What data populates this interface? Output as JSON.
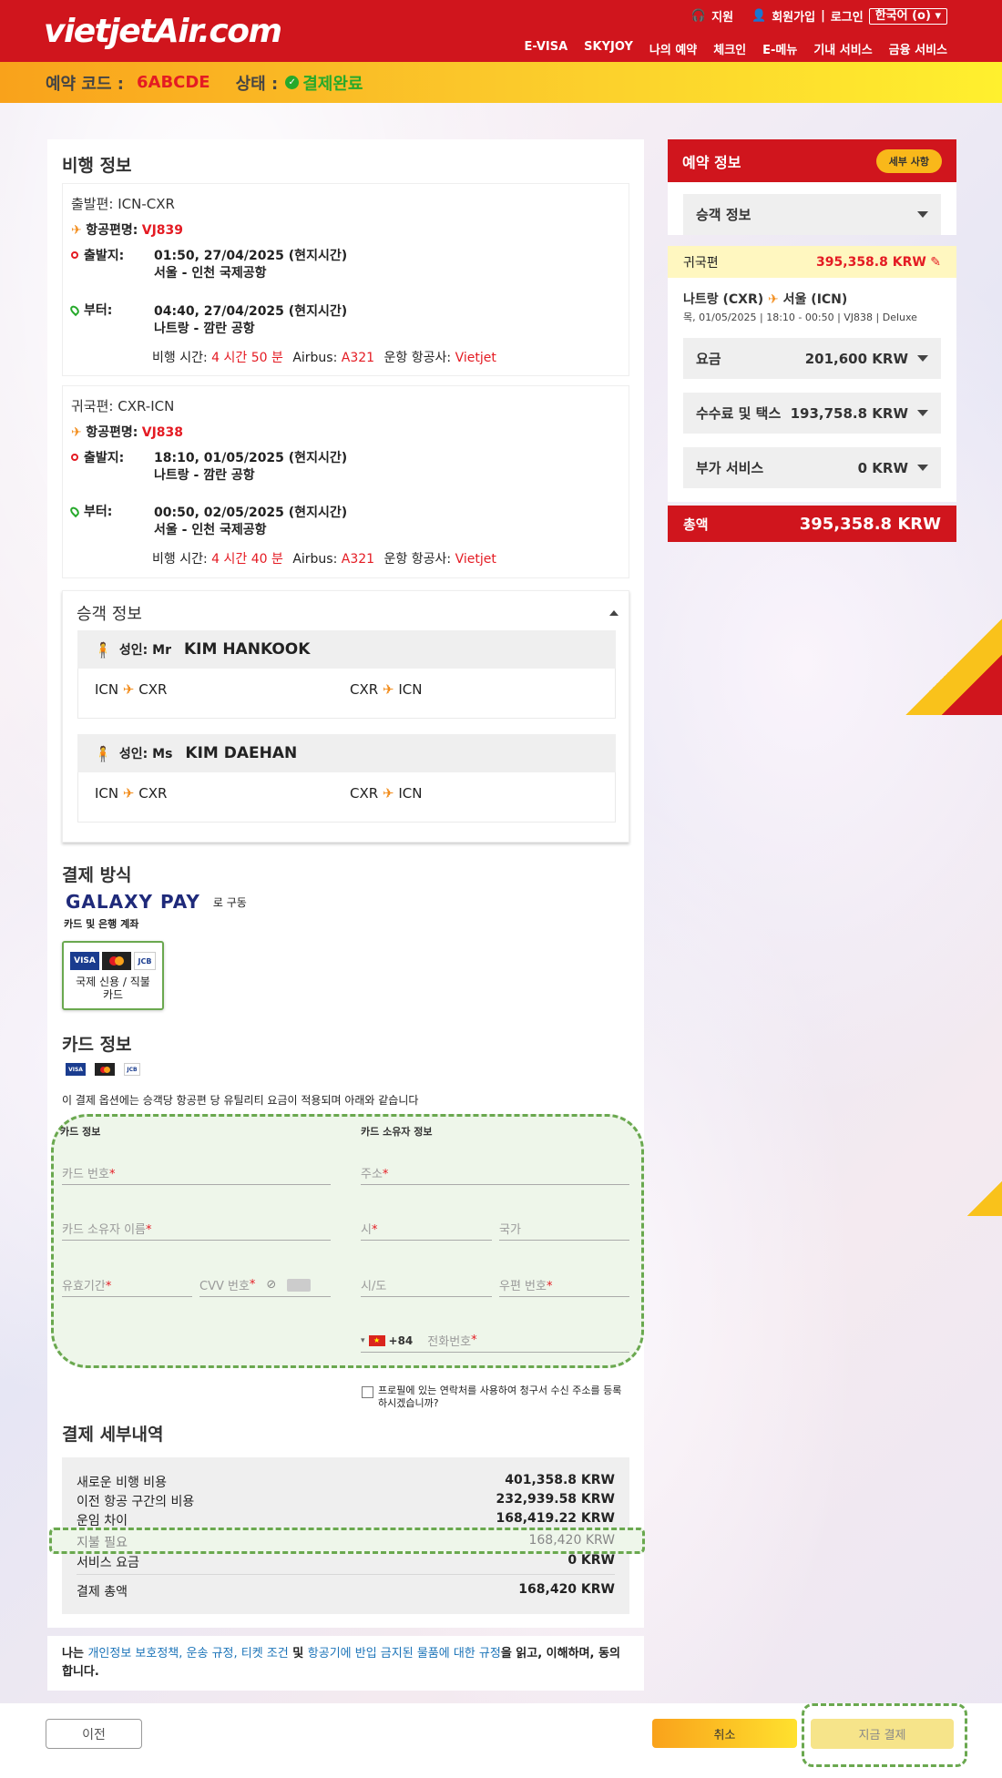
{
  "header": {
    "logo": "vietjetAir.com",
    "support": "지원",
    "signup": "회원가입",
    "login": "로그인",
    "lang": "한국어 (o)",
    "nav": [
      "E-VISA",
      "SKYJOY",
      "나의 예약",
      "체크인",
      "E-메뉴",
      "기내 서비스",
      "금융 서비스"
    ]
  },
  "status_bar": {
    "code_label": "예약 코드 :",
    "code": "6ABCDE",
    "status_label": "상태 :",
    "status": "결제완료"
  },
  "flight_info": {
    "title": "비행 정보",
    "outbound": {
      "title": "출발편: ICN-CXR",
      "flight_label": "항공편명:",
      "flight_no": "VJ839",
      "dep_label": "출발지:",
      "dep_time": "01:50, 27/04/2025 (현지시간)",
      "dep_airport": "서울 - 인천 국제공항",
      "arr_label": "부터:",
      "arr_time": "04:40, 27/04/2025 (현지시간)",
      "arr_airport": "나트랑 - 깜란 공항",
      "dur_label": "비행 시간:",
      "dur": "4 시간 50 분",
      "aircraft_label": "Airbus:",
      "aircraft": "A321",
      "op_label": "운항 항공사:",
      "op": "Vietjet"
    },
    "return": {
      "title": "귀국편: CXR-ICN",
      "flight_label": "항공편명:",
      "flight_no": "VJ838",
      "dep_label": "출발지:",
      "dep_time": "18:10, 01/05/2025 (현지시간)",
      "dep_airport": "나트랑 - 깜란 공항",
      "arr_label": "부터:",
      "arr_time": "00:50, 02/05/2025 (현지시간)",
      "arr_airport": "서울 - 인천 국제공항",
      "dur_label": "비행 시간:",
      "dur": "4 시간 40 분",
      "aircraft_label": "Airbus:",
      "aircraft": "A321",
      "op_label": "운항 항공사:",
      "op": "Vietjet"
    }
  },
  "passengers": {
    "title": "승객 정보",
    "list": [
      {
        "type": "성인: Mr",
        "name": "KIM HANKOOK",
        "route1_from": "ICN",
        "route1_to": "CXR",
        "route2_from": "CXR",
        "route2_to": "ICN"
      },
      {
        "type": "성인: Ms",
        "name": "KIM DAEHAN",
        "route1_from": "ICN",
        "route1_to": "CXR",
        "route2_from": "CXR",
        "route2_to": "ICN"
      }
    ]
  },
  "payment_method": {
    "title": "결제 방식",
    "galaxy": "GALAXY PAY",
    "galaxy_suffix": "로 구동",
    "sub": "카드 및 은행 계좌",
    "card_option": "국제 신용 / 직불 카드"
  },
  "card_info": {
    "title": "카드 정보",
    "note": "이 결제 옵션에는 승객당 항공편 당 유틸리티 요금이 적용되며 아래와 같습니다",
    "card_section": "카드 정보",
    "holder_section": "카드 소유자 정보",
    "card_number": "카드 번호",
    "holder_name": "카드 소유자 이름",
    "expiry": "유효기간",
    "cvv": "CVV 번호",
    "address": "주소",
    "city": "시",
    "country": "국가",
    "state": "시/도",
    "zip": "우편 번호",
    "phone_code": "+84",
    "phone": "전화번호",
    "required": "*",
    "profile_check": "프로필에 있는 연락처를 사용하여 청구서 수신 주소를 등록하시겠습니까?"
  },
  "payment_details": {
    "title": "결제 세부내역",
    "rows": [
      {
        "label": "새로운 비행 비용",
        "value": "401,358.8 KRW"
      },
      {
        "label": "이전 항공 구간의 비용",
        "value": "232,939.58 KRW"
      },
      {
        "label": "운임 차이",
        "value": "168,419.22 KRW"
      },
      {
        "label": "지불 필요",
        "value": "168,420 KRW"
      },
      {
        "label": "서비스 요금",
        "value": "0 KRW"
      }
    ],
    "total_label": "결제 총액",
    "total": "168,420 KRW"
  },
  "terms": {
    "prefix": "나는",
    "link1": "개인정보 보호정책, 운송 규정, 티켓 조건",
    "mid": "및",
    "link2": "항공기에 반입 금지된 물품에 대한 규정",
    "suffix": "을 읽고, 이해하며, 동의합니다."
  },
  "sidebar": {
    "title": "예약 정보",
    "detail_btn": "세부 사항",
    "passenger_drop": "승객 정보",
    "return_label": "귀국편",
    "return_price": "395,358.8 KRW",
    "route_from": "나트랑 (CXR)",
    "route_to": "서울 (ICN)",
    "route_detail": "목, 01/05/2025 | 18:10 - 00:50 | VJ838 | Deluxe",
    "fare_label": "요금",
    "fare": "201,600 KRW",
    "tax_label": "수수료 및 택스",
    "tax": "193,758.8 KRW",
    "addon_label": "부가 서비스",
    "addon": "0 KRW",
    "total_label": "총액",
    "total": "395,358.8 KRW"
  },
  "footer": {
    "prev": "이전",
    "cancel": "취소",
    "pay": "지금 결제"
  },
  "colors": {
    "brand_red": "#d0151d",
    "accent_yellow": "#f9c21b",
    "ok_green": "#26a92b"
  }
}
